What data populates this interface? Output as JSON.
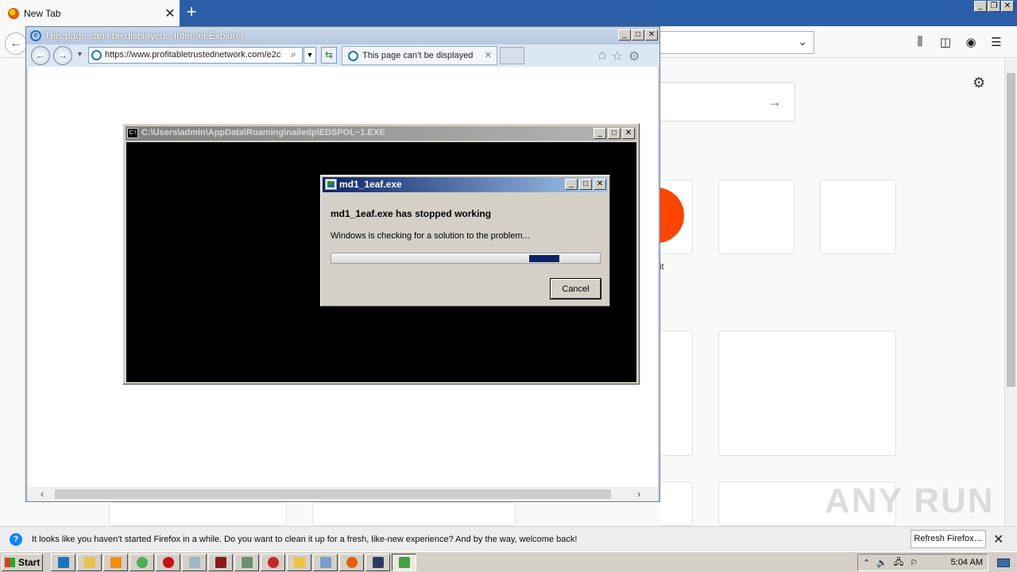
{
  "firefox": {
    "tab_title": "New Tab",
    "tab_close": "✕",
    "new_tab": "+",
    "back_icon": "←",
    "search_arrow": "→",
    "settings_icon": "⚙",
    "reddit_label": "it",
    "notification": {
      "message": "It looks like you haven’t started Firefox in a while. Do you want to clean it up for a fresh, like-new experience? And by the way, welcome back!",
      "refresh_button": "Refresh Firefox…",
      "close": "✕"
    }
  },
  "ie": {
    "title": "This page can’t be displayed - Internet Explorer",
    "address": "https://www.profitabletrustednetwork.com/e2c",
    "tab_title": "This page can’t be displayed",
    "tab_close": "✕"
  },
  "cmd": {
    "title": "C:\\Users\\admin\\AppData\\Roaming\\nailedp\\EDSPOL~1.EXE"
  },
  "error_dialog": {
    "title": "md1_1eaf.exe",
    "heading": "md1_1eaf.exe has stopped working",
    "message": "Windows is checking for a solution to the problem...",
    "progress": 0.83,
    "cancel_label": "Cancel"
  },
  "taskbar": {
    "start_label": "Start",
    "clock": "5:04 AM",
    "task_icons": [
      "ie-icon",
      "explorer-icon",
      "media-player-icon",
      "chrome-icon",
      "opera-icon",
      "notepad-icon",
      "winrar-icon",
      "app-icon",
      "avast-icon",
      "package-icon",
      "document-icon",
      "firefox-icon",
      "cmd-icon",
      "error-report-icon"
    ]
  },
  "watermark": "ANY RUN",
  "colors": {
    "titlebar_active": "#0a246a",
    "progress_fill": "#0a246a",
    "reddit": "#ff4500",
    "firefox_tabstrip": "#2b5ea8"
  }
}
